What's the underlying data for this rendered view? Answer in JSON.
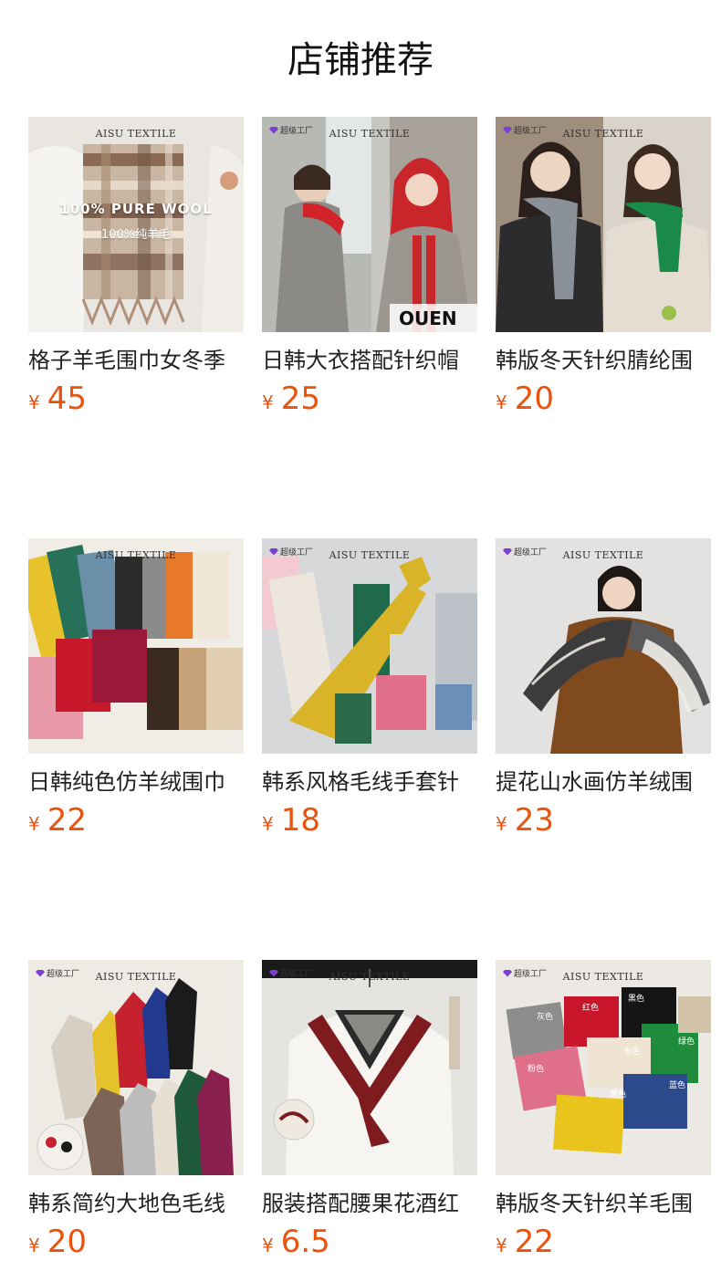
{
  "shop": {
    "title": "店铺推荐"
  },
  "watermark": "AISU TEXTILE",
  "badge": "超级工厂",
  "currency": "¥",
  "overlays": {
    "wool_en": "100% PURE WOOL",
    "wool_cn": "100%纯羊毛"
  },
  "colorLabels": [
    "灰色",
    "红色",
    "黑色",
    "绿色",
    "米色",
    "粉色",
    "黄色",
    "蓝色"
  ],
  "products": [
    {
      "name": "格子羊毛围巾女冬季",
      "price": "45"
    },
    {
      "name": "日韩大衣搭配针织帽",
      "price": "25"
    },
    {
      "name": "韩版冬天针织腈纶围",
      "price": "20"
    },
    {
      "name": "日韩纯色仿羊绒围巾",
      "price": "22"
    },
    {
      "name": "韩系风格毛线手套针",
      "price": "18"
    },
    {
      "name": "提花山水画仿羊绒围",
      "price": "23"
    },
    {
      "name": "韩系简约大地色毛线",
      "price": "20"
    },
    {
      "name": "服装搭配腰果花酒红",
      "price": "6.5"
    },
    {
      "name": "韩版冬天针织羊毛围",
      "price": "22"
    }
  ],
  "colors": {
    "price": "#e8540e",
    "text": "#222222"
  }
}
